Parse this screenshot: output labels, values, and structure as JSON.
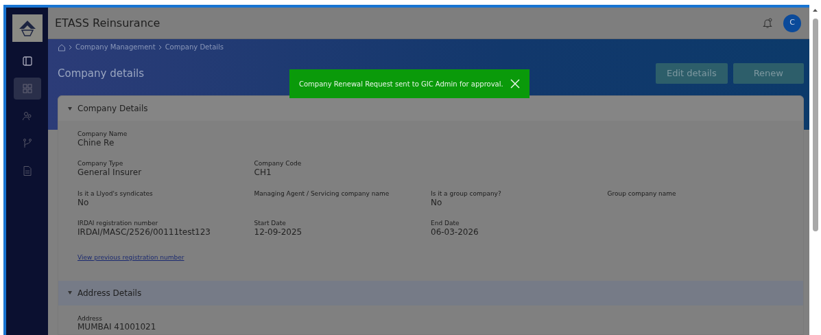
{
  "app": {
    "title": "ETASS Reinsurance",
    "avatar_initial": "C"
  },
  "sidebar": {
    "items": [
      {
        "kind": "panel",
        "selected": false
      },
      {
        "kind": "grid",
        "selected": true
      },
      {
        "kind": "users",
        "selected": false
      },
      {
        "kind": "branch",
        "selected": false
      },
      {
        "kind": "document",
        "selected": false
      }
    ]
  },
  "breadcrumb": [
    "Company Management",
    "Company Details"
  ],
  "page_title": "Company details",
  "buttons": [
    "Edit details",
    "Renew"
  ],
  "toast": {
    "message": "Company Renewal Request sent to GIC Admin for approval."
  },
  "sections": [
    {
      "title": "Company Details",
      "expanded": true,
      "rows": [
        [
          {
            "label": "Company Name",
            "value": "Chine Re"
          }
        ],
        [
          {
            "label": "Company Type",
            "value": "General Insurer"
          },
          {
            "label": "Company Code",
            "value": "CH1"
          }
        ],
        [
          {
            "label": "Is it a Llyod's syndicates",
            "value": "No"
          },
          {
            "label": "Managing Agent / Servicing company name"
          },
          {
            "label": "Is it a group company?",
            "value": "No"
          },
          {
            "label": "Group company name"
          }
        ],
        [
          {
            "label": "IRDAI registration number",
            "value": "IRDAI/MASC/2526/00111test123"
          },
          {
            "label": "Start Date",
            "value": "12-09-2025"
          },
          {
            "label": "End Date",
            "value": "06-03-2026"
          }
        ]
      ],
      "link": "View previous registration number"
    },
    {
      "title": "Address Details",
      "expanded": true,
      "rows": [
        [
          {
            "label": "Address",
            "value": "MUMBAI 41001021"
          }
        ]
      ]
    }
  ]
}
